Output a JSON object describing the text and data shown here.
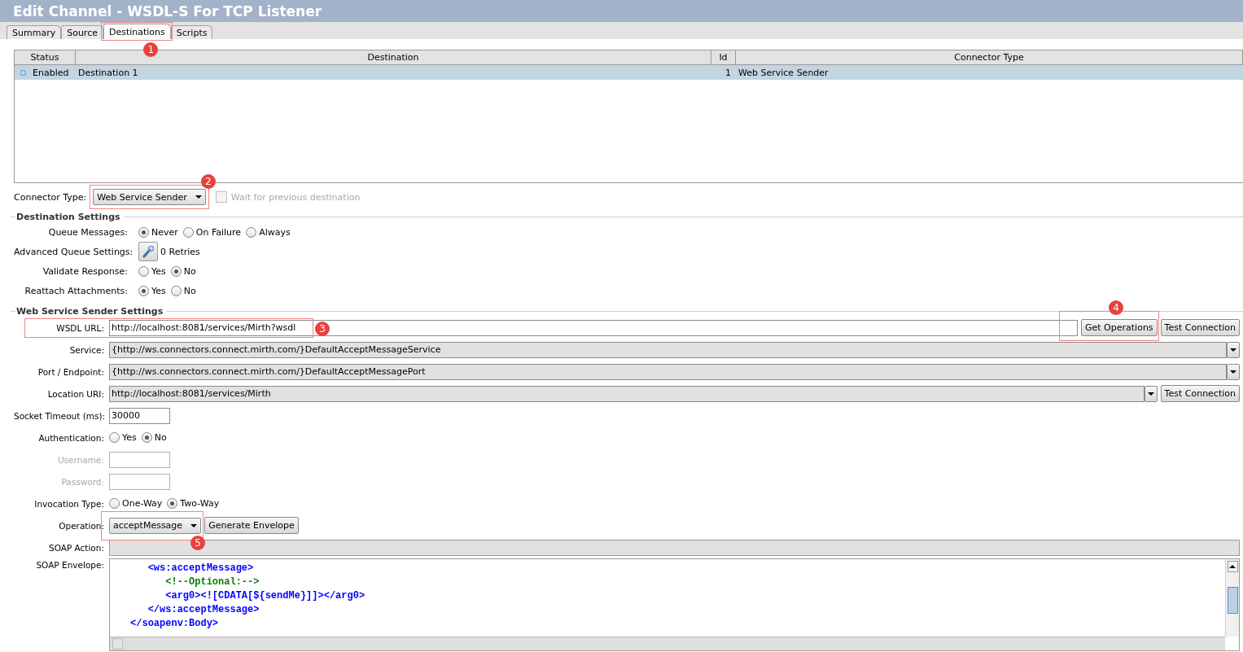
{
  "window": {
    "title": "Edit Channel - WSDL-S For TCP Listener"
  },
  "tabs": [
    {
      "label": "Summary",
      "selected": false
    },
    {
      "label": "Source",
      "selected": false
    },
    {
      "label": "Destinations",
      "selected": true,
      "callout": {
        "number": "1"
      }
    },
    {
      "label": "Scripts",
      "selected": false
    }
  ],
  "table": {
    "columns": [
      "Status",
      "Destination",
      "Id",
      "Connector Type"
    ],
    "rows": [
      {
        "status": "Enabled",
        "destination": "Destination 1",
        "id": "1",
        "connector_type": "Web Service Sender",
        "selected": true
      }
    ]
  },
  "connector_type": {
    "label": "Connector Type:",
    "value": "Web Service Sender",
    "callout": {
      "number": "2"
    }
  },
  "wait_for_previous": {
    "label": "Wait for previous destination",
    "checked": false,
    "disabled": true
  },
  "destination_settings": {
    "title": "Destination Settings",
    "rows": [
      {
        "kind": "radio",
        "label": "Queue Messages:",
        "options": [
          {
            "label": "Never",
            "selected": true
          },
          {
            "label": "On Failure",
            "selected": false
          },
          {
            "label": "Always",
            "selected": false
          }
        ]
      },
      {
        "kind": "wrench",
        "label": "Advanced Queue Settings:",
        "text": "0 Retries"
      },
      {
        "kind": "radio",
        "label": "Validate Response:",
        "options": [
          {
            "label": "Yes",
            "selected": false
          },
          {
            "label": "No",
            "selected": true
          }
        ]
      },
      {
        "kind": "radio",
        "label": "Reattach Attachments:",
        "options": [
          {
            "label": "Yes",
            "selected": true
          },
          {
            "label": "No",
            "selected": false
          }
        ]
      }
    ]
  },
  "web_service_settings": {
    "title": "Web Service Sender Settings",
    "rows": [
      {
        "kind": "longtext",
        "label": "WSDL URL:",
        "value": "http://localhost:8081/services/Mirth?wsdl",
        "callout": {
          "number": "3"
        },
        "buttons": [
          {
            "label": "Get Operations",
            "callout": {
              "number": "4"
            }
          },
          {
            "label": "Test Connection"
          }
        ]
      },
      {
        "kind": "select",
        "label": "Service:",
        "value": "{http://ws.connectors.connect.mirth.com/}DefaultAcceptMessageService"
      },
      {
        "kind": "select",
        "label": "Port / Endpoint:",
        "value": "{http://ws.connectors.connect.mirth.com/}DefaultAcceptMessagePort"
      },
      {
        "kind": "select",
        "label": "Location URI:",
        "value": "http://localhost:8081/services/Mirth",
        "buttons": [
          {
            "label": "Test Connection"
          }
        ]
      },
      {
        "kind": "text",
        "label": "Socket Timeout (ms):",
        "value": "30000"
      },
      {
        "kind": "radio",
        "label": "Authentication:",
        "options": [
          {
            "label": "Yes",
            "selected": false
          },
          {
            "label": "No",
            "selected": true
          }
        ]
      },
      {
        "kind": "text",
        "label": "Username:",
        "disabled": true
      },
      {
        "kind": "text",
        "label": "Password:",
        "disabled": true
      },
      {
        "kind": "radio",
        "label": "Invocation Type:",
        "options": [
          {
            "label": "One-Way",
            "selected": false
          },
          {
            "label": "Two-Way",
            "selected": true
          }
        ]
      },
      {
        "kind": "combo",
        "label": "Operation:",
        "value": "acceptMessage",
        "callout": {
          "number": "5"
        },
        "buttons": [
          {
            "label": "Generate Envelope"
          }
        ]
      },
      {
        "kind": "action",
        "label": "SOAP Action:"
      },
      {
        "kind": "code",
        "label": "SOAP Envelope:",
        "lines": [
          {
            "children": [
              {
                "text": "<ws:acceptMessage>",
                "color": "#0000ff",
                "children": [
                  {
                    "text": "<!--Optional:-->",
                    "color": "#008000"
                  },
                  {
                    "text": "<arg0><![CDATA[${sendMe}]]></arg0>",
                    "color": "#0000ff"
                  }
                ]
              },
              {
                "text": "</ws:acceptMessage>",
                "color": "#0000ff"
              }
            ]
          },
          {
            "text": "</soapenv:Body>",
            "color": "#0000ff"
          }
        ]
      }
    ]
  }
}
